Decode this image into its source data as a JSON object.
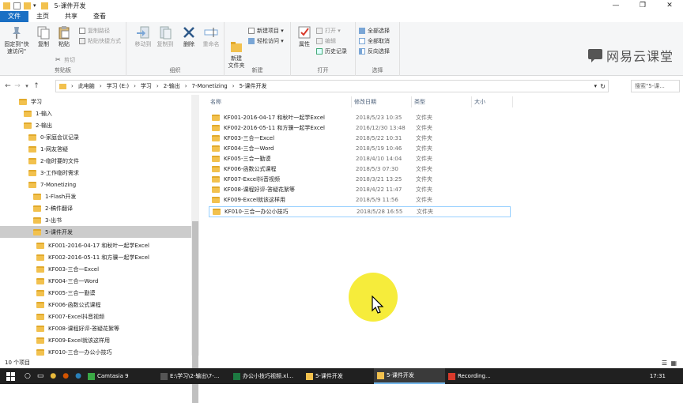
{
  "window": {
    "title": "5-课件开发",
    "controls": [
      "—",
      "❐",
      "✕"
    ]
  },
  "tabs": [
    {
      "label": "文件",
      "active": true
    },
    {
      "label": "主页",
      "active": false
    },
    {
      "label": "共享",
      "active": false
    },
    {
      "label": "查看",
      "active": false
    }
  ],
  "ribbon": {
    "clipboard": {
      "label": "剪贴板",
      "pin": "固定到\"快速访问\"",
      "copy": "复制",
      "paste": "粘贴",
      "copy_path": "复制路径",
      "paste_shortcut": "粘贴快捷方式",
      "cut": "剪切"
    },
    "organize": {
      "label": "组织",
      "move_to": "移动到",
      "copy_to": "复制到",
      "delete": "删除",
      "rename": "重命名"
    },
    "new": {
      "label": "新建",
      "new_folder": "新建\n文件夹",
      "new_item": "新建项目 ▾",
      "easy_access": "轻松访问 ▾"
    },
    "open": {
      "label": "打开",
      "properties": "属性",
      "open": "打开 ▾",
      "edit": "编辑",
      "history": "历史记录"
    },
    "select": {
      "label": "选择",
      "select_all": "全部选择",
      "select_none": "全部取消",
      "invert": "反向选择"
    }
  },
  "logo": {
    "text": "网易云课堂",
    "color": "#555555"
  },
  "address": {
    "crumbs": [
      "此电脑",
      "学习 (E:)",
      "学习",
      "2-输出",
      "7-Monetizing",
      "5-课件开发"
    ],
    "separator": "›",
    "search_placeholder": "搜索\"5-课..."
  },
  "nav_tree": [
    {
      "label": "学习",
      "indent": 0,
      "selected": false
    },
    {
      "label": "1-输入",
      "indent": 1,
      "selected": false
    },
    {
      "label": "2-输出",
      "indent": 1,
      "selected": false
    },
    {
      "label": "0-家庭会议记录",
      "indent": 2,
      "selected": false
    },
    {
      "label": "1-网友答疑",
      "indent": 2,
      "selected": false
    },
    {
      "label": "2-临时要的文件",
      "indent": 2,
      "selected": false
    },
    {
      "label": "3-工作临时需求",
      "indent": 2,
      "selected": false
    },
    {
      "label": "7-Monetizing",
      "indent": 2,
      "selected": false
    },
    {
      "label": "1-Flash开发",
      "indent": 3,
      "selected": false
    },
    {
      "label": "2-稿件翻译",
      "indent": 3,
      "selected": false
    },
    {
      "label": "3-出书",
      "indent": 3,
      "selected": false
    },
    {
      "label": "5-课件开发",
      "indent": 3,
      "selected": true
    },
    {
      "label": "KF001-2016-04-17 和秋叶一起学Excel",
      "indent": 4,
      "selected": false
    },
    {
      "label": "KF002-2016-05-11 和方骥一起学Excel",
      "indent": 4,
      "selected": false
    },
    {
      "label": "KF003-三合一Excel",
      "indent": 4,
      "selected": false
    },
    {
      "label": "KF004-三合一Word",
      "indent": 4,
      "selected": false
    },
    {
      "label": "KF005-三合一勤谟",
      "indent": 4,
      "selected": false
    },
    {
      "label": "KF006-函数公式课程",
      "indent": 4,
      "selected": false
    },
    {
      "label": "KF007-Excel抖音视频",
      "indent": 4,
      "selected": false
    },
    {
      "label": "KF008-课程好评-答疑花絮等",
      "indent": 4,
      "selected": false
    },
    {
      "label": "KF009-Excel就该这样用",
      "indent": 4,
      "selected": false
    },
    {
      "label": "KF010-三合一办公小技巧",
      "indent": 4,
      "selected": false
    }
  ],
  "columns": {
    "name": "名称",
    "date": "修改日期",
    "type": "类型",
    "size": "大小"
  },
  "files": [
    {
      "name": "KF001-2016-04-17 和秋叶一起学Excel",
      "date": "2018/5/23 10:35",
      "type": "文件夹",
      "selected": false
    },
    {
      "name": "KF002-2016-05-11 和方骥一起学Excel",
      "date": "2016/12/30 13:48",
      "type": "文件夹",
      "selected": false
    },
    {
      "name": "KF003-三合一Excel",
      "date": "2018/5/22 10:31",
      "type": "文件夹",
      "selected": false
    },
    {
      "name": "KF004-三合一Word",
      "date": "2018/5/19 10:46",
      "type": "文件夹",
      "selected": false
    },
    {
      "name": "KF005-三合一勤谟",
      "date": "2018/4/10 14:04",
      "type": "文件夹",
      "selected": false
    },
    {
      "name": "KF006-函数公式课程",
      "date": "2018/5/3 07:30",
      "type": "文件夹",
      "selected": false
    },
    {
      "name": "KF007-Excel抖音视频",
      "date": "2018/3/21 13:25",
      "type": "文件夹",
      "selected": false
    },
    {
      "name": "KF008-课程好评-答疑花絮等",
      "date": "2018/4/22 11:47",
      "type": "文件夹",
      "selected": false
    },
    {
      "name": "KF009-Excel就该这样用",
      "date": "2018/5/9 11:56",
      "type": "文件夹",
      "selected": false
    },
    {
      "name": "KF010-三合一办公小技巧",
      "date": "2018/5/28 16:55",
      "type": "文件夹",
      "selected": true
    }
  ],
  "status": {
    "item_count": "10 个项目"
  },
  "taskbar": {
    "tasks": [
      {
        "label": "Camtasia 9",
        "color": "#3aa845",
        "active": false
      },
      {
        "label": "E:\\学习\\2-输出\\7-...",
        "color": "#1e1e1e",
        "active": false
      },
      {
        "label": "办公小技巧视频.xl...",
        "color": "#1d7a42",
        "active": false
      },
      {
        "label": "5-课件开发",
        "color": "#f2c14e",
        "active": false
      },
      {
        "label": "5-课件开发",
        "color": "#f2c14e",
        "active": true
      },
      {
        "label": "Recording...",
        "color": "#d93a2b",
        "active": false
      }
    ],
    "time": "17:31"
  },
  "colors": {
    "accent": "#1a6fc4",
    "folder": "#f2c14e",
    "highlight": "#f5ea2a"
  }
}
